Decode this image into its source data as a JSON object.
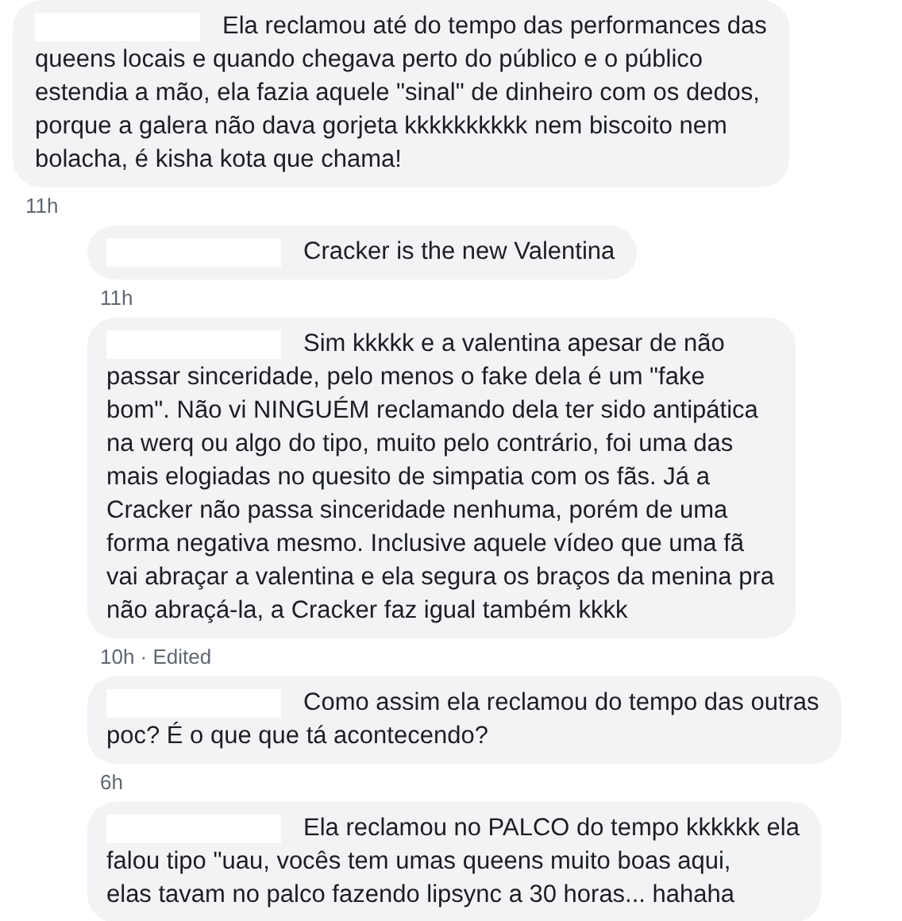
{
  "comments": [
    {
      "text": "Ela reclamou até do tempo das performances das\nqueens locais e quando chegava perto do público e o público\nestendia a mão, ela fazia aquele \"sinal\" de dinheiro com os dedos,\nporque a galera não dava gorjeta kkkkkkkkkk nem biscoito nem\nbolacha, é kisha kota que chama!",
      "time": "11h",
      "reply": false
    },
    {
      "text": "Cracker is the new Valentina",
      "time": "11h",
      "reply": true
    },
    {
      "text": "Sim kkkkk e a valentina apesar de não\npassar sinceridade, pelo menos o fake dela é um \"fake\nbom\". Não vi NINGUÉM reclamando dela ter sido antipática\nna werq ou algo do tipo, muito pelo contrário, foi uma das\nmais elogiadas no quesito de simpatia com os fãs. Já a\nCracker não passa sinceridade nenhuma, porém de uma\nforma negativa mesmo. Inclusive aquele vídeo que uma fã\nvai abraçar a valentina e ela segura os braços da menina pra\nnão abraçá-la, a Cracker faz igual também kkkk",
      "time": "10h · Edited",
      "reply": true
    },
    {
      "text": "Como assim ela reclamou do tempo das outras\npoc? É o que que tá acontecendo?",
      "time": "6h",
      "reply": true
    },
    {
      "text": "Ela reclamou no PALCO do tempo kkkkkk ela\nfalou tipo \"uau, vocês tem umas queens muito boas aqui,\nelas tavam no palco fazendo lipsync a 30 horas... hahaha",
      "reply": true
    }
  ]
}
